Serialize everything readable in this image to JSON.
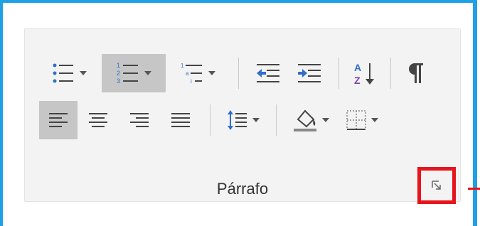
{
  "group": {
    "label": "Párrafo"
  },
  "icons": {
    "row1": [
      "bullets-icon",
      "numbering-icon",
      "multilevel-list-icon",
      "decrease-indent-icon",
      "increase-indent-icon",
      "sort-icon",
      "pilcrow-icon"
    ],
    "row2": [
      "align-left-icon",
      "center-icon",
      "align-right-icon",
      "justify-icon",
      "line-spacing-icon",
      "shading-icon",
      "borders-icon"
    ]
  },
  "colors": {
    "frame": "#1ea0e6",
    "highlight": "#e8141b",
    "accent_blue": "#2f6fca",
    "selected_bg": "#c6c6c6"
  },
  "state": {
    "numbering_selected": true,
    "align_left_selected": true
  }
}
